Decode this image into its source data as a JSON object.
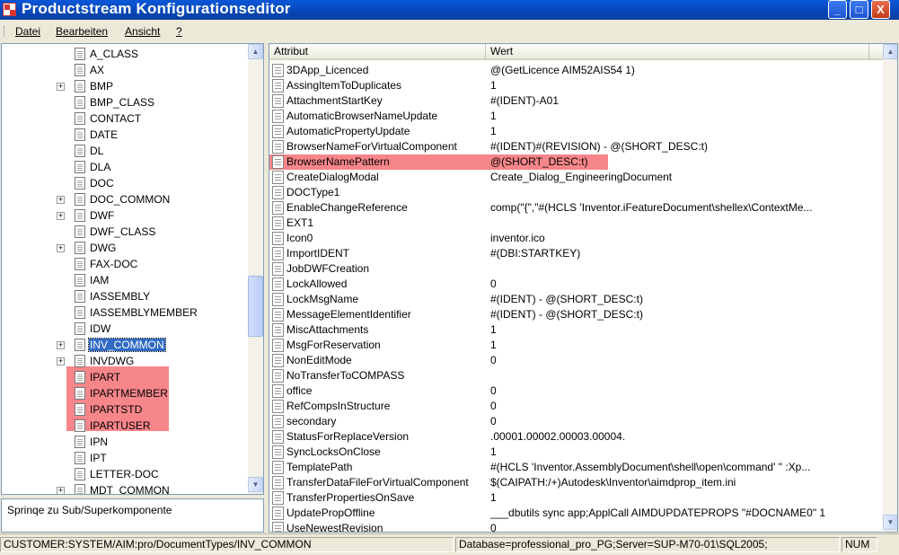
{
  "window": {
    "title": "Productstream Konfigurationseditor",
    "minimize_label": "_",
    "maximize_label": "□",
    "close_label": "X"
  },
  "menu": [
    "Datei",
    "Bearbeiten",
    "Ansicht",
    "?"
  ],
  "tree": {
    "items": [
      {
        "label": "A_CLASS",
        "expandable": false
      },
      {
        "label": "AX",
        "expandable": false
      },
      {
        "label": "BMP",
        "expandable": true
      },
      {
        "label": "BMP_CLASS",
        "expandable": false
      },
      {
        "label": "CONTACT",
        "expandable": false
      },
      {
        "label": "DATE",
        "expandable": false
      },
      {
        "label": "DL",
        "expandable": false
      },
      {
        "label": "DLA",
        "expandable": false
      },
      {
        "label": "DOC",
        "expandable": false
      },
      {
        "label": "DOC_COMMON",
        "expandable": true
      },
      {
        "label": "DWF",
        "expandable": true
      },
      {
        "label": "DWF_CLASS",
        "expandable": false
      },
      {
        "label": "DWG",
        "expandable": true
      },
      {
        "label": "FAX-DOC",
        "expandable": false
      },
      {
        "label": "IAM",
        "expandable": false
      },
      {
        "label": "IASSEMBLY",
        "expandable": false
      },
      {
        "label": "IASSEMBLYMEMBER",
        "expandable": false
      },
      {
        "label": "IDW",
        "expandable": false
      },
      {
        "label": "INV_COMMON",
        "expandable": true,
        "selected": true
      },
      {
        "label": "INVDWG",
        "expandable": true
      },
      {
        "label": "IPART",
        "expandable": false
      },
      {
        "label": "IPARTMEMBER",
        "expandable": false
      },
      {
        "label": "IPARTSTD",
        "expandable": false
      },
      {
        "label": "IPARTUSER",
        "expandable": false
      },
      {
        "label": "IPN",
        "expandable": false
      },
      {
        "label": "IPT",
        "expandable": false
      },
      {
        "label": "LETTER-DOC",
        "expandable": false
      },
      {
        "label": "MDT_COMMON",
        "expandable": true
      }
    ]
  },
  "jump_label": "Sprinqe zu Sub/Superkomponente",
  "properties": {
    "col_attribute": "Attribut",
    "col_value": "Wert",
    "rows": [
      {
        "name": "3DApp_Licenced",
        "value": "@(GetLicence AIM52AIS54 1)"
      },
      {
        "name": "AssingItemToDuplicates",
        "value": "1"
      },
      {
        "name": "AttachmentStartKey",
        "value": "#(IDENT)-A01"
      },
      {
        "name": "AutomaticBrowserNameUpdate",
        "value": "1"
      },
      {
        "name": "AutomaticPropertyUpdate",
        "value": "1"
      },
      {
        "name": "BrowserNameForVirtualComponent",
        "value": "#(IDENT)#(REVISION) - @(SHORT_DESC:t)"
      },
      {
        "name": "BrowserNamePattern",
        "value": "@(SHORT_DESC:t)",
        "highlighted": true
      },
      {
        "name": "CreateDialogModal",
        "value": "Create_Dialog_EngineeringDocument"
      },
      {
        "name": "DOCType1",
        "value": ""
      },
      {
        "name": "EnableChangeReference",
        "value": "comp(\"{\",\"#(HCLS 'Inventor.iFeatureDocument\\shellex\\ContextMe..."
      },
      {
        "name": "EXT1",
        "value": ""
      },
      {
        "name": "Icon0",
        "value": "inventor.ico"
      },
      {
        "name": "ImportIDENT",
        "value": "#(DBI:STARTKEY)"
      },
      {
        "name": "JobDWFCreation",
        "value": ""
      },
      {
        "name": "LockAllowed",
        "value": "0"
      },
      {
        "name": "LockMsgName",
        "value": "#(IDENT) - @(SHORT_DESC:t)"
      },
      {
        "name": "MessageElementIdentifier",
        "value": "#(IDENT) - @(SHORT_DESC:t)"
      },
      {
        "name": "MiscAttachments",
        "value": "1"
      },
      {
        "name": "MsgForReservation",
        "value": "1"
      },
      {
        "name": "NonEditMode",
        "value": "0"
      },
      {
        "name": "NoTransferToCOMPASS",
        "value": ""
      },
      {
        "name": "office",
        "value": "0"
      },
      {
        "name": "RefCompsInStructure",
        "value": "0"
      },
      {
        "name": "secondary",
        "value": "0"
      },
      {
        "name": "StatusForReplaceVersion",
        "value": ".00001.00002.00003.00004."
      },
      {
        "name": "SyncLocksOnClose",
        "value": "1"
      },
      {
        "name": "TemplatePath",
        "value": "#(HCLS 'Inventor.AssemblyDocument\\shell\\open\\command' \" :Xp..."
      },
      {
        "name": "TransferDataFileForVirtualComponent",
        "value": "$(CAIPATH:/+)Autodesk\\Inventor\\aimdprop_item.ini"
      },
      {
        "name": "TransferPropertiesOnSave",
        "value": "1"
      },
      {
        "name": "UpdatePropOffline",
        "value": "___dbutils sync app;ApplCall AIMDUPDATEPROPS \"#DOCNAME0\" 1"
      },
      {
        "name": "UseNewestRevision",
        "value": "0"
      }
    ]
  },
  "status": {
    "path": "CUSTOMER:SYSTEM/AIM:pro/DocumentTypes/INV_COMMON",
    "database": "Database=professional_pro_PG;Server=SUP-M70-01\\SQL2005;",
    "num": "NUM"
  },
  "colors": {
    "highlight": "#f7868a",
    "selection": "#316ac5",
    "titlebar": "#0747b7"
  }
}
